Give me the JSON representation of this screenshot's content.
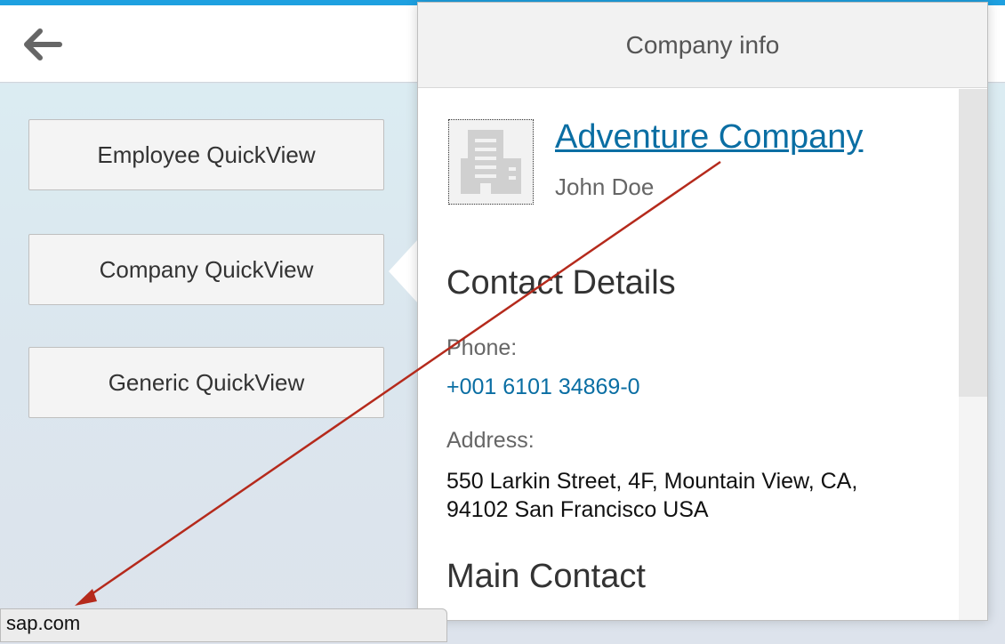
{
  "header": {
    "back_icon": "back-arrow-icon"
  },
  "buttons": {
    "employee": "Employee QuickView",
    "company": "Company QuickView",
    "generic": "Generic QuickView"
  },
  "popover": {
    "title": "Company info",
    "company": {
      "logo_icon": "building-icon",
      "name": "Adventure Company",
      "contact_name": "John Doe"
    },
    "contact_details": {
      "title": "Contact Details",
      "phone_label": "Phone:",
      "phone": "+001 6101 34869-0",
      "address_label": "Address:",
      "address_line1": "550 Larkin Street, 4F, Mountain View, CA,",
      "address_line2": "94102 San Francisco USA"
    },
    "main_contact": {
      "title": "Main Contact"
    }
  },
  "status_bar": {
    "url": "sap.com"
  },
  "colors": {
    "accent": "#1ea0e0",
    "link": "#0a6ea3",
    "annotation_arrow": "#b52a1c"
  }
}
